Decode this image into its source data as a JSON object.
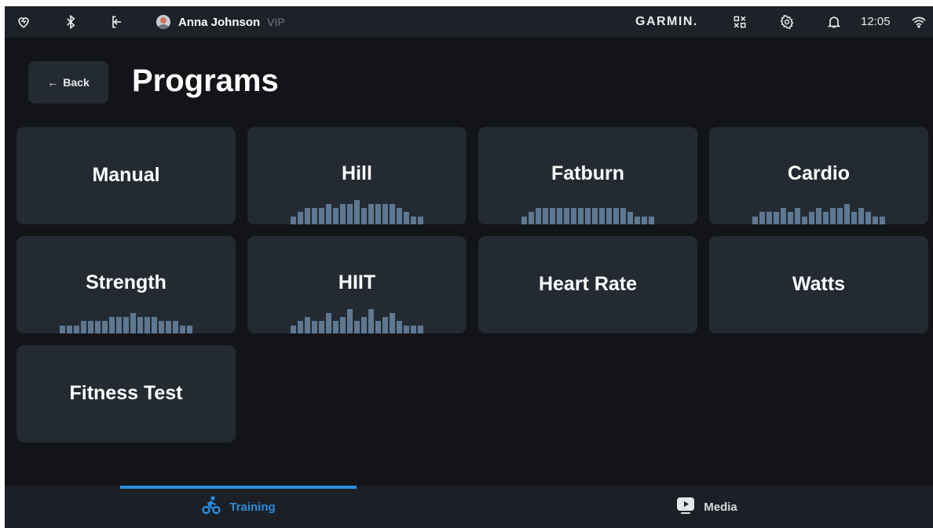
{
  "status_bar": {
    "icons": [
      "heart-icon",
      "bluetooth-icon",
      "logout-icon"
    ],
    "user_name": "Anna Johnson",
    "user_badge": "VIP",
    "brand": "GARMIN.",
    "right_icons": [
      "qr-code-icon",
      "gear-icon",
      "bell-icon",
      "wifi-icon"
    ],
    "time": "12:05"
  },
  "header": {
    "back_label": "Back",
    "title": "Programs"
  },
  "programs": [
    {
      "label": "Manual",
      "profile": []
    },
    {
      "label": "Hill",
      "profile": [
        2,
        3,
        4,
        4,
        4,
        5,
        4,
        5,
        5,
        6,
        4,
        5,
        5,
        5,
        5,
        4,
        3,
        2,
        2
      ]
    },
    {
      "label": "Fatburn",
      "profile": [
        2,
        3,
        4,
        4,
        4,
        4,
        4,
        4,
        4,
        4,
        4,
        4,
        4,
        4,
        4,
        3,
        2,
        2,
        2
      ]
    },
    {
      "label": "Cardio",
      "profile": [
        2,
        3,
        3,
        3,
        4,
        3,
        4,
        2,
        3,
        4,
        3,
        4,
        4,
        5,
        3,
        4,
        3,
        2,
        2
      ]
    },
    {
      "label": "Strength",
      "profile": [
        2,
        2,
        2,
        3,
        3,
        3,
        3,
        4,
        4,
        4,
        5,
        4,
        4,
        4,
        3,
        3,
        3,
        2,
        2
      ]
    },
    {
      "label": "HIIT",
      "profile": [
        2,
        3,
        4,
        3,
        3,
        5,
        3,
        4,
        6,
        3,
        4,
        6,
        3,
        4,
        5,
        3,
        2,
        2,
        2
      ]
    },
    {
      "label": "Heart Rate",
      "profile": []
    },
    {
      "label": "Watts",
      "profile": []
    },
    {
      "label": "Fitness Test",
      "profile": []
    }
  ],
  "bottom_nav": {
    "training_label": "Training",
    "media_label": "Media"
  },
  "colors": {
    "background": "#121418",
    "card": "#232a32",
    "bar": "#5f7891",
    "accent": "#2b8de0"
  }
}
